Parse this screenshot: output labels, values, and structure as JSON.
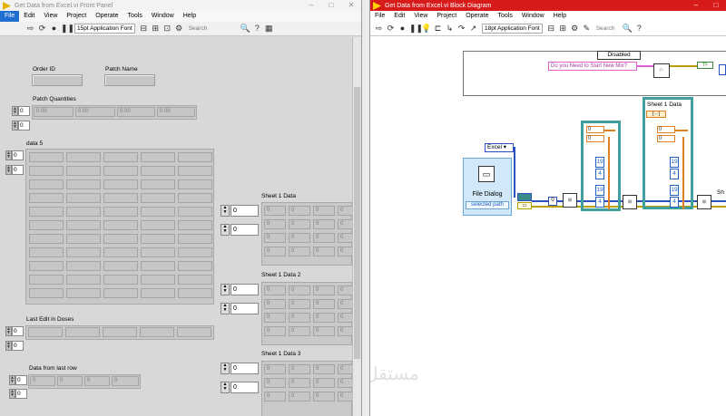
{
  "front_panel": {
    "title": "Get Data from Excel.vi Front Panel",
    "menus": [
      "File",
      "Edit",
      "View",
      "Project",
      "Operate",
      "Tools",
      "Window",
      "Help"
    ],
    "font_select": "15pt Application Font",
    "search_placeholder": "Search",
    "labels": {
      "order_id": "Order ID",
      "patch_name": "Patch Name",
      "patch_quantities": "Patch Quantities",
      "data5": "data 5",
      "last_edit": "Last Edit in Doses",
      "data_last_row": "Data from last row",
      "sheet1": "Sheet 1 Data",
      "sheet2": "Sheet 1 Data 2",
      "sheet3": "Sheet 1 Data 3"
    },
    "patch_quantity_values": [
      "0.00",
      "0.00",
      "0.00",
      "0.00"
    ],
    "last_row_values": [
      "0",
      "0",
      "0",
      "0"
    ],
    "sheet_cell_value": "0",
    "index_value": "0"
  },
  "block_diagram": {
    "title": "Get Data from Excel.vi Block Diagram",
    "menus": [
      "File",
      "Edit",
      "View",
      "Project",
      "Operate",
      "Tools",
      "Window",
      "Help"
    ],
    "font_select": "18pt Application Font",
    "search_placeholder": "Search",
    "disabled_label": "Disabled",
    "prompt_text": "Do you Need to Start New Mix?",
    "excel_label": "Excel",
    "file_dialog_label": "File Dialog",
    "selected_path": "selected path",
    "sheet1_label": "Sheet 1 Data",
    "sheet_short": "Sh",
    "const19": "19",
    "const4": "4",
    "const0": "0"
  },
  "colors": {
    "bd_title": "#d71a1a",
    "panel_bg": "#d8d8d8",
    "wire_blue": "#2a52be",
    "wire_orange": "#e08020",
    "frame_teal": "#40a0a0"
  },
  "watermark": "مستقل"
}
